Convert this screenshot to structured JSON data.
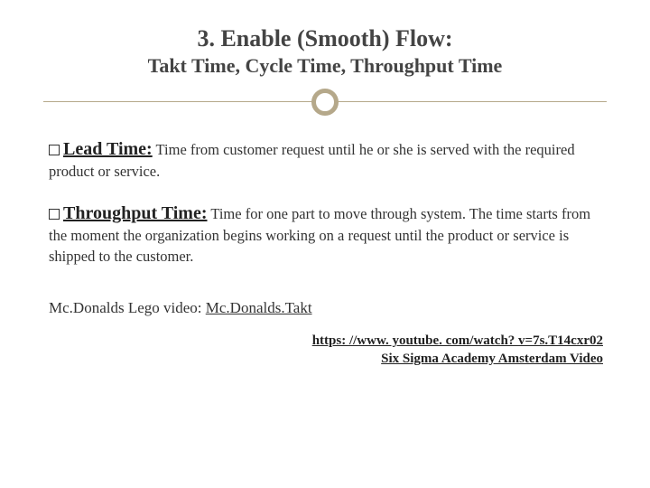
{
  "title": "3. Enable (Smooth) Flow:",
  "subtitle": "Takt Time, Cycle Time, Throughput Time",
  "items": [
    {
      "term": "Lead Time:",
      "desc": " Time from customer request until he or she is served with the required product or service."
    },
    {
      "term": "Throughput Time:",
      "desc": " Time for one part to move through system. The time starts from the moment the organization begins working on a request until the product or service is shipped to the customer."
    }
  ],
  "video_prefix": "Mc.Donalds Lego video: ",
  "video_link": "Mc.Donalds.Takt",
  "footer_url": "https: //www. youtube. com/watch? v=7s.T14cxr02",
  "footer_label": "Six Sigma Academy Amsterdam Video"
}
